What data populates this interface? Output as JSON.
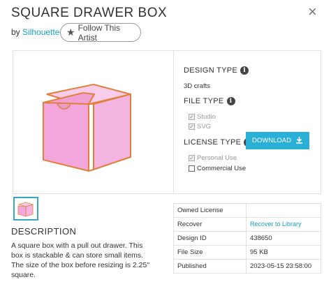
{
  "title": "SQUARE DRAWER BOX",
  "byline": {
    "prefix": "by",
    "artist": "Silhouette"
  },
  "follow_button": "Follow This Artist",
  "close_symbol": "×",
  "design_type": {
    "heading": "DESIGN TYPE",
    "value": "3D crafts"
  },
  "file_type": {
    "heading": "FILE TYPE",
    "options": [
      {
        "label": "Studio",
        "checked": true,
        "enabled": false
      },
      {
        "label": "SVG",
        "checked": true,
        "enabled": false
      }
    ]
  },
  "license_type": {
    "heading": "LICENSE TYPE",
    "options": [
      {
        "label": "Personal Use",
        "checked": true,
        "enabled": false
      },
      {
        "label": "Commercial Use",
        "checked": false,
        "enabled": true
      }
    ]
  },
  "download_button": "DOWNLOAD",
  "description": {
    "heading": "DESCRIPTION",
    "text": "A square box with a pull out drawer. This box is stackable & can store small items. The size of the box before resizing is 2.25\" square."
  },
  "details": {
    "owned_license": {
      "label": "Owned License",
      "value": ""
    },
    "recover": {
      "label": "Recover",
      "link": "Recover to Library"
    },
    "design_id": {
      "label": "Design ID",
      "value": "438650"
    },
    "file_size": {
      "label": "File Size",
      "value": "95 KB"
    },
    "published": {
      "label": "Published",
      "value": "2023-05-15 23:58:00"
    }
  },
  "colors": {
    "accent": "#2ab0d6",
    "link": "#17a2c4",
    "box_pink": "#f2a6dc",
    "box_edge": "#e0803a"
  },
  "icons": [
    "star-icon",
    "info-icon",
    "download-icon",
    "close-icon"
  ]
}
